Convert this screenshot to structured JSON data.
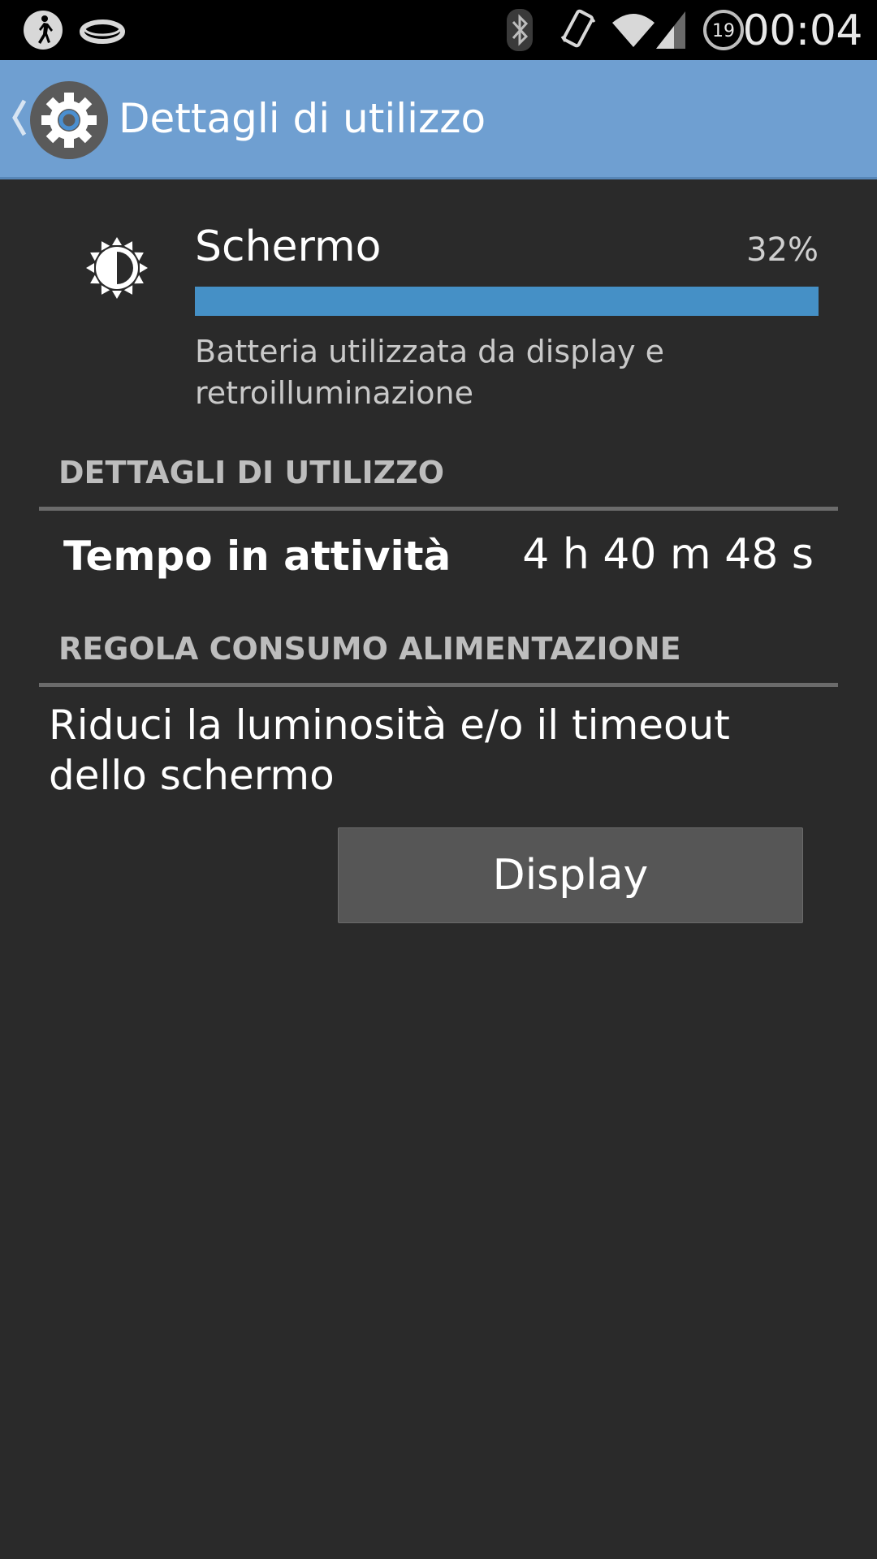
{
  "status_bar": {
    "time": "00:04",
    "notification_badge": "19",
    "icons": [
      "walking-figure-icon",
      "ring-icon",
      "bluetooth-icon",
      "vibrate-icon",
      "wifi-icon",
      "signal-icon",
      "timer-badge-icon"
    ]
  },
  "action_bar": {
    "title": "Dettagli di utilizzo",
    "icon": "settings-gear-icon",
    "back_icon": "chevron-left-icon"
  },
  "usage": {
    "name": "Schermo",
    "percent": "32%",
    "fill_fraction": 1.0,
    "description": "Batteria utilizzata da display e retroilluminazione",
    "icon": "brightness-icon",
    "bar_color": "#4590c6"
  },
  "details_section": {
    "header": "DETTAGLI DI UTILIZZO",
    "rows": [
      {
        "label": "Tempo in attività",
        "value": "4 h 40 m 48 s"
      }
    ]
  },
  "adjust_section": {
    "header": "REGOLA CONSUMO ALIMENTAZIONE",
    "tip": "Riduci la luminosità e/o il timeout dello schermo",
    "button_label": "Display"
  },
  "colors": {
    "action_bar": "#6f9fd1",
    "background": "#2a2a2a",
    "accent": "#4590c6"
  }
}
